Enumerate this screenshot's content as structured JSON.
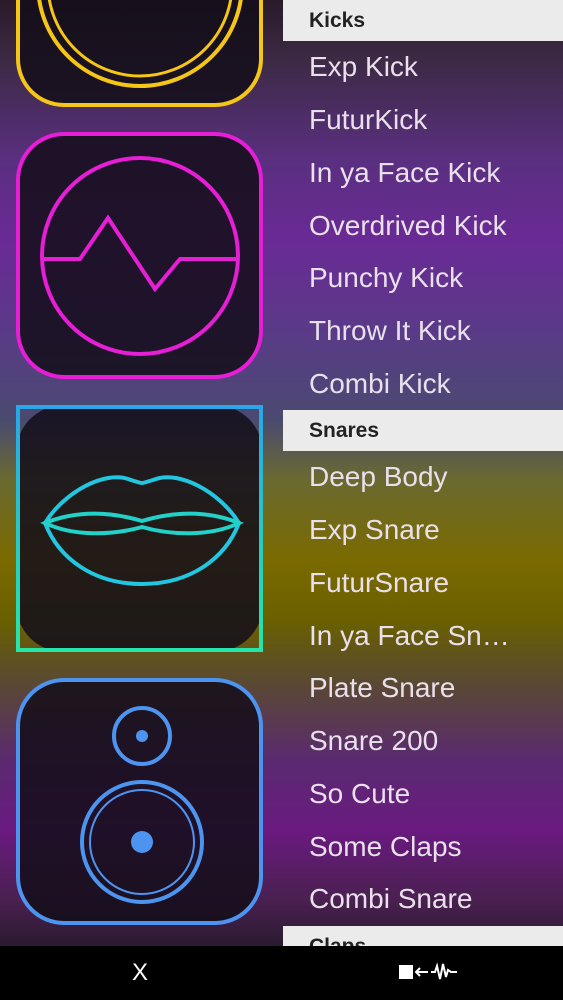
{
  "categories": [
    {
      "header": "Kicks",
      "items": [
        "Exp Kick",
        "FuturKick",
        "In ya Face Kick",
        "Overdrived Kick",
        "Punchy Kick",
        "Throw It Kick",
        "Combi Kick"
      ]
    },
    {
      "header": "Snares",
      "items": [
        "Deep Body",
        "Exp Snare",
        "FuturSnare",
        "In ya Face Sn…",
        "Plate Snare",
        "Snare 200",
        "So Cute",
        "Some Claps",
        "Combi Snare"
      ]
    },
    {
      "header": "Claps",
      "items": []
    }
  ],
  "tiles": [
    {
      "icon": "kick-drum-icon",
      "color": "#f5c518"
    },
    {
      "icon": "waveform-circle-icon",
      "color": "#e61ed6"
    },
    {
      "icon": "lips-icon",
      "color": "#22c6e0"
    },
    {
      "icon": "speaker-icon",
      "color": "#4d94f0"
    }
  ],
  "bottom_bar": {
    "close_label": "X",
    "back_icon": "stop-back-waveform-icon"
  }
}
